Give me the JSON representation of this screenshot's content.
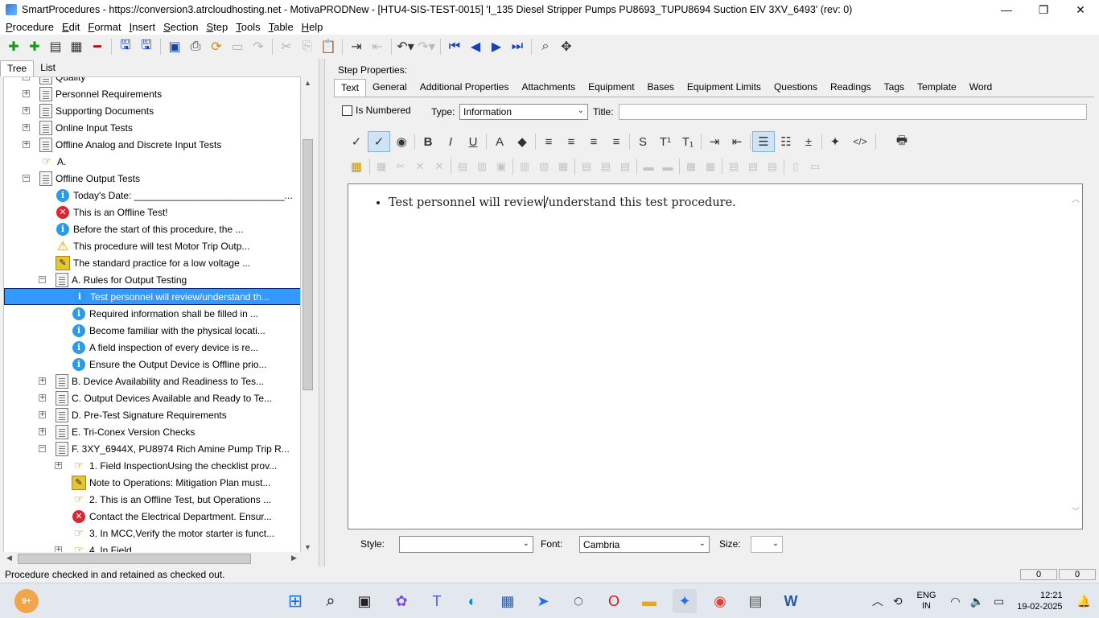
{
  "window": {
    "title": "SmartProcedures - https://conversion3.atrcloudhosting.net - MotivaPRODNew - [HTU4-SIS-TEST-0015] 'I_135 Diesel Stripper Pumps PU8693_TUPU8694 Suction EIV 3XV_6493' (rev: 0)",
    "minimize": "—",
    "restore": "❐",
    "close": "✕"
  },
  "menu": [
    "Procedure",
    "Edit",
    "Format",
    "Insert",
    "Section",
    "Step",
    "Tools",
    "Table",
    "Help"
  ],
  "left_tabs": [
    "Tree",
    "List"
  ],
  "tree": [
    {
      "label": "Quality",
      "icon": "doc-icon",
      "indent": 0,
      "expander": "+"
    },
    {
      "label": "Personnel Requirements",
      "icon": "doc-icon",
      "indent": 0,
      "expander": "+"
    },
    {
      "label": "Supporting Documents",
      "icon": "doc-icon",
      "indent": 0,
      "expander": "+"
    },
    {
      "label": "Online Input Tests",
      "icon": "doc-icon",
      "indent": 0,
      "expander": "+"
    },
    {
      "label": "Offline Analog and Discrete Input Tests",
      "icon": "doc-icon",
      "indent": 0,
      "expander": "+"
    },
    {
      "label": "A.",
      "icon": "pointer-icon",
      "indent": 0,
      "expander": ""
    },
    {
      "label": "Offline Output Tests",
      "icon": "doc-icon",
      "indent": 0,
      "expander": "−"
    },
    {
      "label": "Today's Date: ____________________________...",
      "icon": "info-icon",
      "indent": 1,
      "expander": ""
    },
    {
      "label": "This is an Offline Test!",
      "icon": "error-icon",
      "indent": 1,
      "expander": ""
    },
    {
      "label": "Before the start of this procedure, the ...",
      "icon": "info-icon",
      "indent": 1,
      "expander": ""
    },
    {
      "label": "This procedure will test Motor Trip Outp...",
      "icon": "warning-icon",
      "indent": 1,
      "expander": ""
    },
    {
      "label": "The standard practice for a low voltage ...",
      "icon": "note-icon",
      "indent": 1,
      "expander": ""
    },
    {
      "label": "A. Rules for Output Testing",
      "icon": "doc-icon",
      "indent": 1,
      "expander": "−"
    },
    {
      "label": "Test personnel will review/understand th...",
      "icon": "info-icon",
      "indent": 2,
      "expander": "",
      "selected": true
    },
    {
      "label": "Required information shall be filled in ...",
      "icon": "info-icon",
      "indent": 2,
      "expander": ""
    },
    {
      "label": "Become familiar with the physical locati...",
      "icon": "info-icon",
      "indent": 2,
      "expander": ""
    },
    {
      "label": "A field inspection of every device is re...",
      "icon": "info-icon",
      "indent": 2,
      "expander": ""
    },
    {
      "label": "Ensure the Output Device is Offline prio...",
      "icon": "info-icon",
      "indent": 2,
      "expander": ""
    },
    {
      "label": "B. Device Availability and Readiness to Tes...",
      "icon": "doc-icon",
      "indent": 1,
      "expander": "+"
    },
    {
      "label": "C. Output Devices Available and Ready to Te...",
      "icon": "doc-icon",
      "indent": 1,
      "expander": "+"
    },
    {
      "label": "D. Pre-Test Signature Requirements",
      "icon": "doc-icon",
      "indent": 1,
      "expander": "+"
    },
    {
      "label": "E. Tri-Conex Version Checks",
      "icon": "doc-icon",
      "indent": 1,
      "expander": "+"
    },
    {
      "label": "F. 3XY_6944X, PU8974 Rich Amine Pump Trip R...",
      "icon": "doc-icon",
      "indent": 1,
      "expander": "−"
    },
    {
      "label": "1. Field InspectionUsing the checklist prov...",
      "icon": "pointer-icon",
      "indent": 2,
      "expander": "+"
    },
    {
      "label": "Note to Operations: Mitigation Plan must...",
      "icon": "note-icon",
      "indent": 2,
      "expander": ""
    },
    {
      "label": "2. This is an Offline Test, but Operations ...",
      "icon": "pointer-icon",
      "indent": 2,
      "expander": ""
    },
    {
      "label": "Contact the Electrical Department. Ensur...",
      "icon": "error-icon",
      "indent": 2,
      "expander": ""
    },
    {
      "label": "3. In MCC,Verify the motor starter is funct...",
      "icon": "pointer-icon",
      "indent": 2,
      "expander": ""
    },
    {
      "label": "4. In Field",
      "icon": "pointer-icon",
      "indent": 2,
      "expander": "+"
    }
  ],
  "step_properties": {
    "label": "Step Properties:",
    "tabs": [
      "Text",
      "General",
      "Additional Properties",
      "Attachments",
      "Equipment",
      "Bases",
      "Equipment Limits",
      "Questions",
      "Readings",
      "Tags",
      "Template",
      "Word"
    ],
    "is_numbered_label": "Is Numbered",
    "type_label": "Type:",
    "type_value": "Information",
    "title_label": "Title:",
    "title_value": "",
    "editor_text_before_caret": "Test personnel will review",
    "editor_text_after_caret": "/understand this test procedure.",
    "style_label": "Style:",
    "style_value": "",
    "font_label": "Font:",
    "font_value": "Cambria",
    "size_label": "Size:",
    "size_value": ""
  },
  "format_buttons_row1": [
    {
      "icon": "spellcheck-icon",
      "glyph": "✓"
    },
    {
      "icon": "spellcheck-auto-icon",
      "glyph": "✓",
      "active": true
    },
    {
      "icon": "styles-icon",
      "glyph": "◉"
    },
    {
      "icon": "bold-icon",
      "glyph": "B"
    },
    {
      "icon": "italic-icon",
      "glyph": "I"
    },
    {
      "icon": "underline-icon",
      "glyph": "U"
    },
    {
      "icon": "font-color-icon",
      "glyph": "A"
    },
    {
      "icon": "highlight-icon",
      "glyph": "◆"
    },
    {
      "icon": "align-left-icon",
      "glyph": "≡"
    },
    {
      "icon": "align-center-icon",
      "glyph": "≡"
    },
    {
      "icon": "align-right-icon",
      "glyph": "≡"
    },
    {
      "icon": "justify-icon",
      "glyph": "≡"
    },
    {
      "icon": "strikethrough-icon",
      "glyph": "S"
    },
    {
      "icon": "superscript-icon",
      "glyph": "T¹"
    },
    {
      "icon": "subscript-icon",
      "glyph": "T₁"
    },
    {
      "icon": "indent-icon",
      "glyph": "⇥"
    },
    {
      "icon": "outdent-icon",
      "glyph": "⇤"
    },
    {
      "icon": "bullet-list-icon",
      "glyph": "☰",
      "active": true
    },
    {
      "icon": "numbered-list-icon",
      "glyph": "☷"
    },
    {
      "icon": "insert-line-icon",
      "glyph": "±"
    },
    {
      "icon": "magic-wand-icon",
      "glyph": "✦"
    },
    {
      "icon": "html-source-icon",
      "glyph": "</>"
    },
    {
      "icon": "print-icon",
      "glyph": "🖶"
    }
  ],
  "taskbar": {
    "notification_badge": "9+",
    "lang_top": "ENG",
    "lang_bottom": "IN",
    "time": "12:21",
    "date": "19-02-2025"
  },
  "status": {
    "message": "Procedure checked in and retained as checked out.",
    "cell1": "0",
    "cell2": "0"
  }
}
